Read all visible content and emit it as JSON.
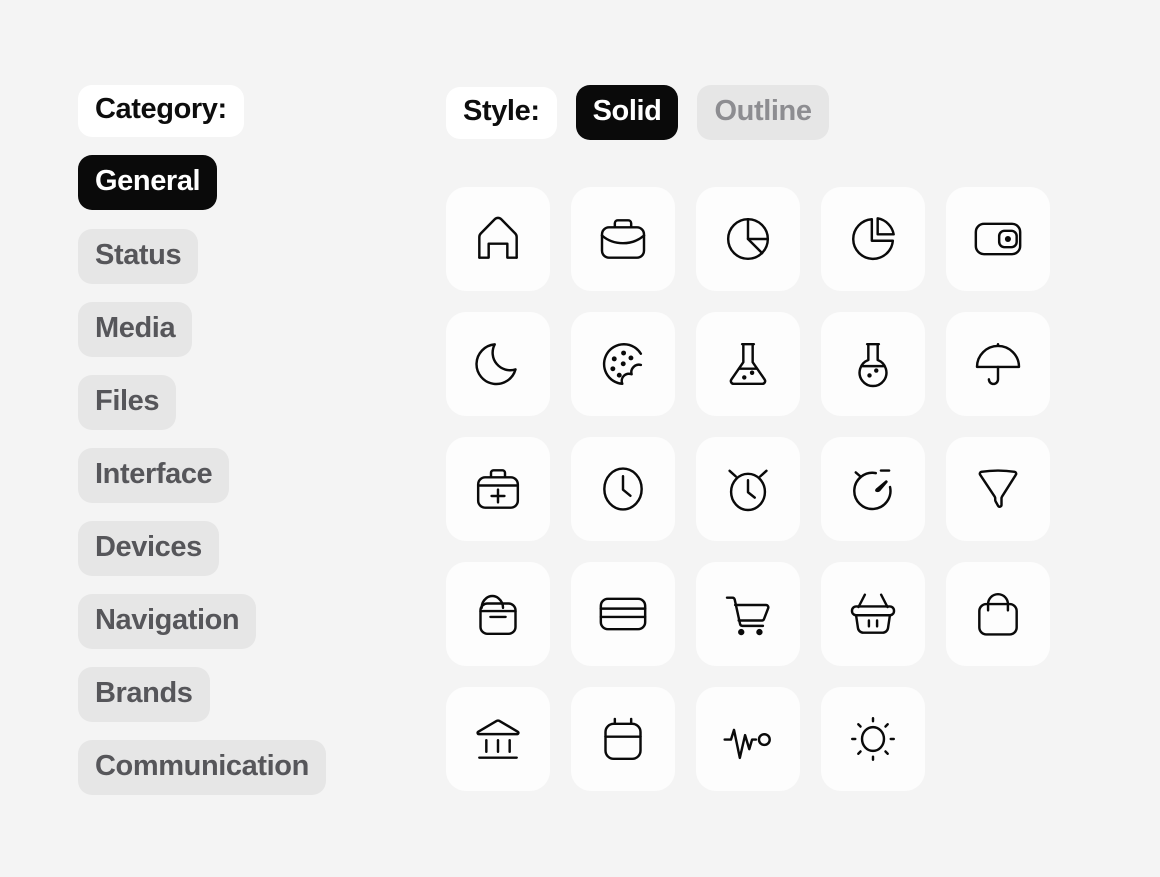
{
  "sidebar": {
    "label": "Category:",
    "items": [
      {
        "label": "General",
        "state": "active"
      },
      {
        "label": "Status",
        "state": "idle"
      },
      {
        "label": "Media",
        "state": "idle"
      },
      {
        "label": "Files",
        "state": "idle"
      },
      {
        "label": "Interface",
        "state": "idle"
      },
      {
        "label": "Devices",
        "state": "idle"
      },
      {
        "label": "Navigation",
        "state": "idle"
      },
      {
        "label": "Brands",
        "state": "idle"
      },
      {
        "label": "Communication",
        "state": "idle"
      }
    ]
  },
  "style_bar": {
    "label": "Style:",
    "options": [
      {
        "label": "Solid",
        "state": "selected"
      },
      {
        "label": "Outline",
        "state": "unselected"
      }
    ]
  },
  "grid": {
    "columns": 5,
    "icons": [
      {
        "name": "home-icon"
      },
      {
        "name": "briefcase-icon"
      },
      {
        "name": "pie-chart-icon"
      },
      {
        "name": "pie-chart-separated-icon"
      },
      {
        "name": "wallet-icon"
      },
      {
        "name": "moon-icon"
      },
      {
        "name": "cookie-icon"
      },
      {
        "name": "flask-conical-icon"
      },
      {
        "name": "flask-round-icon"
      },
      {
        "name": "umbrella-icon"
      },
      {
        "name": "first-aid-kit-icon"
      },
      {
        "name": "clock-icon"
      },
      {
        "name": "alarm-clock-icon"
      },
      {
        "name": "stopwatch-icon"
      },
      {
        "name": "funnel-filter-icon"
      },
      {
        "name": "package-box-icon"
      },
      {
        "name": "credit-card-icon"
      },
      {
        "name": "shopping-cart-icon"
      },
      {
        "name": "shopping-basket-icon"
      },
      {
        "name": "shopping-bag-icon"
      },
      {
        "name": "bank-icon"
      },
      {
        "name": "calendar-icon"
      },
      {
        "name": "pulse-activity-icon"
      },
      {
        "name": "sun-icon"
      }
    ]
  },
  "colors": {
    "background": "#f4f4f4",
    "card": "#fdfdfd",
    "chip_idle_bg": "#e6e6e6",
    "chip_idle_text": "#56565a",
    "chip_active_bg": "#0a0a0a",
    "chip_active_text": "#ffffff",
    "chip_label_bg": "#ffffff",
    "icon_stroke": "#0a0a0a"
  }
}
